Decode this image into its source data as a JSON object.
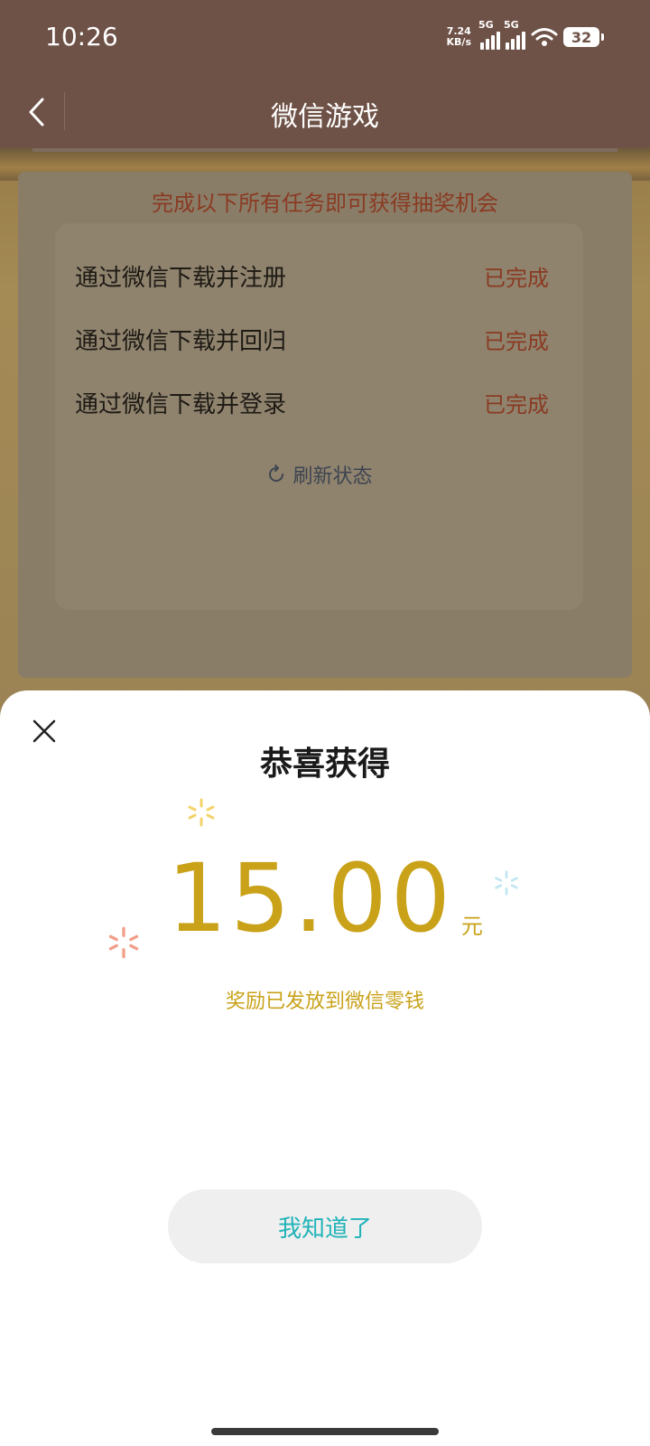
{
  "status_bar": {
    "time": "10:26",
    "net_speed_value": "7.24",
    "net_speed_unit": "KB/s",
    "signal1_label": "5G",
    "signal2_label": "5G",
    "battery": "32"
  },
  "header": {
    "title": "微信游戏"
  },
  "tasks": {
    "heading": "完成以下所有任务即可获得抽奖机会",
    "items": [
      {
        "name": "通过微信下载并注册",
        "status": "已完成"
      },
      {
        "name": "通过微信下载并回归",
        "status": "已完成"
      },
      {
        "name": "通过微信下载并登录",
        "status": "已完成"
      }
    ],
    "refresh_label": "刷新状态"
  },
  "dialog": {
    "title": "恭喜获得",
    "amount": "15.00",
    "unit": "元",
    "note": "奖励已发放到微信零钱",
    "confirm_label": "我知道了"
  },
  "colors": {
    "accent_gold": "#c9a21a",
    "button_text_teal": "#21b3b8",
    "status_red": "#8a3a22",
    "header_brown": "#6f5247"
  },
  "icons": {
    "back": "chevron-left-icon",
    "close": "close-icon",
    "refresh": "refresh-icon",
    "wifi": "wifi-icon",
    "battery": "battery-icon",
    "sparkle": "sparkle-icon"
  }
}
